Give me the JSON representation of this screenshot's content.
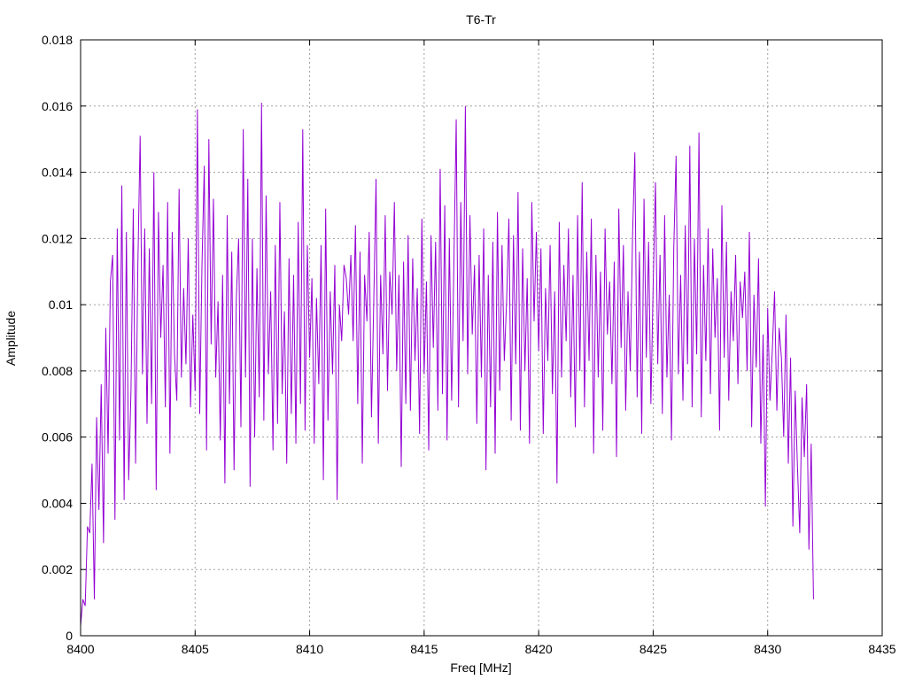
{
  "chart_data": {
    "type": "line",
    "title": "T6-Tr",
    "xlabel": "Freq [MHz]",
    "ylabel": "Amplitude",
    "xlim": [
      8400,
      8435
    ],
    "ylim": [
      0,
      0.018
    ],
    "xticks": [
      8400,
      8405,
      8410,
      8415,
      8420,
      8425,
      8430,
      8435
    ],
    "yticks": [
      0,
      0.002,
      0.004,
      0.006,
      0.008,
      0.01,
      0.012,
      0.014,
      0.016,
      0.018
    ],
    "ytick_labels": [
      "0",
      "0.002",
      "0.004",
      "0.006",
      "0.008",
      "0.01",
      "0.012",
      "0.014",
      "0.016",
      "0.018"
    ],
    "grid": true,
    "colors": {
      "series": "#9400d3",
      "grid": "#a0a0a0",
      "axes": "#000000"
    },
    "series": [
      {
        "x_start": 8400.0,
        "x_step": 0.1,
        "values": [
          0.0003,
          0.0011,
          0.0009,
          0.0033,
          0.0031,
          0.0052,
          0.0011,
          0.0066,
          0.0038,
          0.0076,
          0.0028,
          0.0093,
          0.0055,
          0.0107,
          0.0115,
          0.0035,
          0.0123,
          0.0059,
          0.0136,
          0.0041,
          0.0122,
          0.0047,
          0.0074,
          0.0129,
          0.0052,
          0.0112,
          0.0151,
          0.0079,
          0.0123,
          0.0064,
          0.0117,
          0.007,
          0.014,
          0.0044,
          0.0128,
          0.009,
          0.0112,
          0.0069,
          0.0131,
          0.0055,
          0.0122,
          0.0085,
          0.0071,
          0.0135,
          0.0078,
          0.0105,
          0.0082,
          0.012,
          0.0069,
          0.0097,
          0.0074,
          0.0159,
          0.0067,
          0.0112,
          0.0142,
          0.0056,
          0.015,
          0.0088,
          0.0132,
          0.0078,
          0.0101,
          0.0059,
          0.0109,
          0.0046,
          0.0127,
          0.007,
          0.0116,
          0.005,
          0.0102,
          0.012,
          0.0063,
          0.0153,
          0.0078,
          0.0138,
          0.0045,
          0.012,
          0.006,
          0.0111,
          0.0072,
          0.0161,
          0.0065,
          0.0133,
          0.0079,
          0.0104,
          0.0056,
          0.0118,
          0.0064,
          0.0131,
          0.0073,
          0.0098,
          0.0052,
          0.0114,
          0.0067,
          0.0109,
          0.0058,
          0.0125,
          0.007,
          0.0153,
          0.0062,
          0.0118,
          0.0084,
          0.0108,
          0.0058,
          0.0102,
          0.0076,
          0.0118,
          0.0047,
          0.0129,
          0.0065,
          0.0104,
          0.0079,
          0.0112,
          0.0041,
          0.01,
          0.0089,
          0.0112,
          0.0108,
          0.0097,
          0.0115,
          0.0089,
          0.0124,
          0.007,
          0.0116,
          0.0052,
          0.0109,
          0.0095,
          0.0122,
          0.0066,
          0.0101,
          0.0138,
          0.0058,
          0.0109,
          0.0085,
          0.0127,
          0.0074,
          0.011,
          0.0097,
          0.0131,
          0.008,
          0.0109,
          0.0051,
          0.0113,
          0.007,
          0.0121,
          0.0068,
          0.0114,
          0.0083,
          0.0105,
          0.0061,
          0.0126,
          0.0079,
          0.0107,
          0.0056,
          0.0121,
          0.0087,
          0.0119,
          0.0068,
          0.0141,
          0.0073,
          0.013,
          0.0059,
          0.012,
          0.0071,
          0.0113,
          0.0156,
          0.0069,
          0.0131,
          0.0089,
          0.016,
          0.0079,
          0.0127,
          0.0091,
          0.0112,
          0.0064,
          0.0115,
          0.0078,
          0.0123,
          0.005,
          0.0109,
          0.0069,
          0.0119,
          0.0055,
          0.0128,
          0.0074,
          0.0118,
          0.0083,
          0.0101,
          0.0126,
          0.0065,
          0.0121,
          0.0082,
          0.0134,
          0.0062,
          0.0117,
          0.008,
          0.0108,
          0.0058,
          0.0131,
          0.0095,
          0.0122,
          0.0086,
          0.0117,
          0.0061,
          0.0105,
          0.0083,
          0.0118,
          0.0073,
          0.0104,
          0.0046,
          0.0125,
          0.0078,
          0.0112,
          0.0089,
          0.0123,
          0.0072,
          0.0109,
          0.0063,
          0.0127,
          0.008,
          0.0137,
          0.0069,
          0.0116,
          0.0083,
          0.0126,
          0.0055,
          0.0115,
          0.0078,
          0.011,
          0.0062,
          0.0123,
          0.0091,
          0.0107,
          0.0076,
          0.0113,
          0.0054,
          0.0129,
          0.0087,
          0.0118,
          0.0068,
          0.0104,
          0.008,
          0.0121,
          0.0146,
          0.0072,
          0.0116,
          0.0061,
          0.0132,
          0.0084,
          0.0119,
          0.007,
          0.0106,
          0.0137,
          0.0082,
          0.0115,
          0.0067,
          0.0127,
          0.0078,
          0.0103,
          0.0059,
          0.0117,
          0.0145,
          0.0079,
          0.0109,
          0.0071,
          0.0124,
          0.0082,
          0.0148,
          0.0069,
          0.012,
          0.0085,
          0.0152,
          0.0066,
          0.0112,
          0.0083,
          0.0123,
          0.0073,
          0.0117,
          0.009,
          0.0108,
          0.0062,
          0.013,
          0.0084,
          0.0119,
          0.0071,
          0.0104,
          0.0089,
          0.0115,
          0.0076,
          0.0107,
          0.0096,
          0.011,
          0.008,
          0.0122,
          0.0063,
          0.0103,
          0.0081,
          0.0114,
          0.0058,
          0.0091,
          0.0039,
          0.0099,
          0.0071,
          0.0086,
          0.0104,
          0.0068,
          0.0093,
          0.0084,
          0.006,
          0.0097,
          0.0052,
          0.0084,
          0.0033,
          0.0074,
          0.0051,
          0.0031,
          0.0072,
          0.0054,
          0.0076,
          0.0026,
          0.0058,
          0.0011
        ]
      }
    ]
  }
}
